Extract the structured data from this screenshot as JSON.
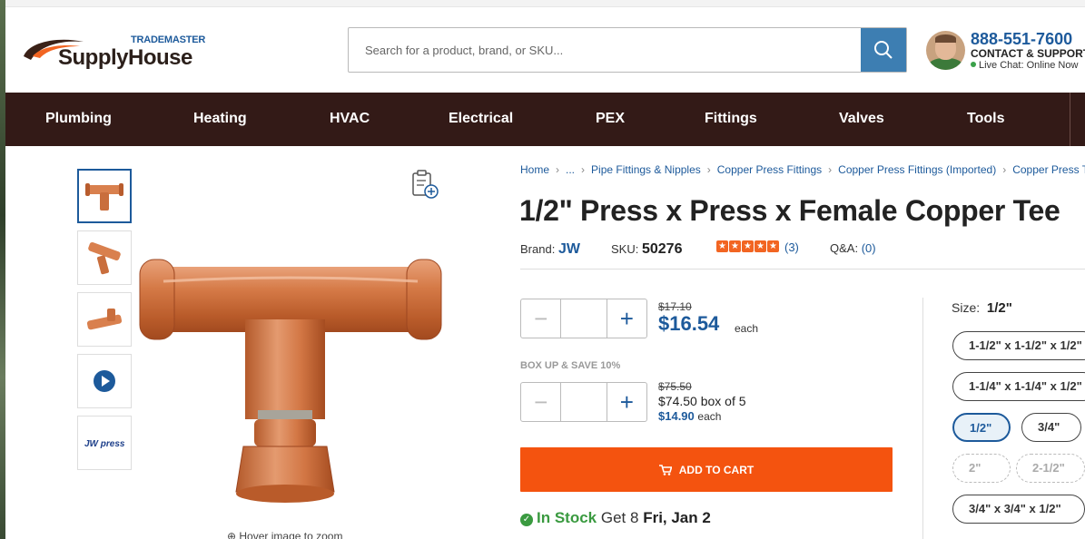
{
  "header": {
    "logo_top": "TRADEMASTER",
    "logo_name": "SupplyHouse",
    "search_placeholder": "Search for a product, brand, or SKU...",
    "phone": "888-551-7600",
    "contact": "CONTACT & SUPPORT",
    "chat": "Live Chat: Online Now"
  },
  "nav": [
    "Plumbing",
    "Heating",
    "HVAC",
    "Electrical",
    "PEX",
    "Fittings",
    "Valves",
    "Tools"
  ],
  "gallery": {
    "thumb_logo_text": "JW press",
    "zoom_hint": "Hover image to zoom"
  },
  "breadcrumb": [
    "Home",
    "...",
    "Pipe Fittings & Nipples",
    "Copper Press Fittings",
    "Copper Press Fittings (Imported)",
    "Copper Press Tees"
  ],
  "product": {
    "title": "1/2\" Press x Press x Female Copper Tee",
    "brand_label": "Brand:",
    "brand": "JW",
    "sku_label": "SKU:",
    "sku": "50276",
    "rating": 5,
    "reviews": "(3)",
    "qa_label": "Q&A:",
    "qa": "(0)"
  },
  "pricing": {
    "old_price": "$17.10",
    "price": "$16.54",
    "each": "each",
    "boxup": "BOX UP & SAVE 10%",
    "box_old_price": "$75.50",
    "box_price": "$74.50 box of 5",
    "unit_price": "$14.90",
    "unit_each": "each",
    "add_to_cart": "ADD TO CART"
  },
  "stock": {
    "status": "In Stock",
    "get": "Get 8",
    "date": "Fri, Jan 2"
  },
  "sizes": {
    "label": "Size:",
    "selected": "1/2\"",
    "options": [
      {
        "label": "1-1/2\" x 1-1/2\" x 1/2\"",
        "state": "normal"
      },
      {
        "label": "1-1/4\" x 1-1/4\" x 1/2\"",
        "state": "normal"
      },
      {
        "label": "1/2\"",
        "state": "selected"
      },
      {
        "label": "3/4\"",
        "state": "normal"
      },
      {
        "label": "2\"",
        "state": "disabled"
      },
      {
        "label": "2-1/2\"",
        "state": "disabled"
      },
      {
        "label": "3/4\" x 3/4\" x 1/2\"",
        "state": "normal"
      }
    ]
  },
  "colors": {
    "nav_bg": "#331a17",
    "brand_blue": "#1d5a9b",
    "cart_orange": "#f4530f",
    "stock_green": "#3a9a40"
  }
}
